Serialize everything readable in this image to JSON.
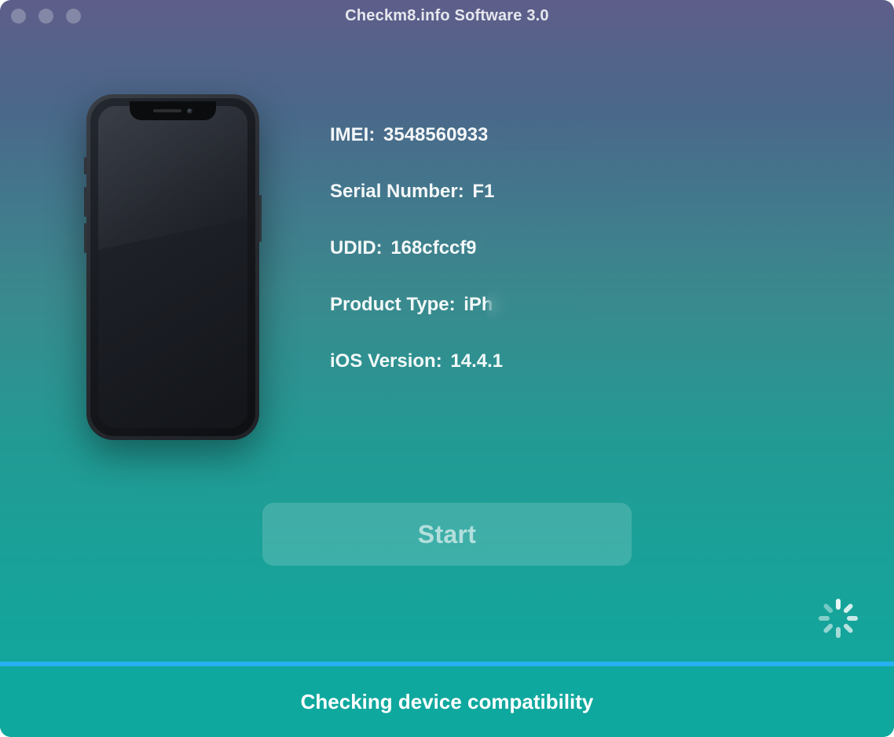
{
  "window": {
    "title": "Checkm8.info Software 3.0"
  },
  "device": {
    "imei": {
      "label": "IMEI:",
      "value_visible": "3548560933"
    },
    "serial": {
      "label": "Serial Number:",
      "value_visible": "F1"
    },
    "udid": {
      "label": "UDID:",
      "value_visible": "168cfccf9"
    },
    "product": {
      "label": "Product Type:",
      "value_visible": "iPh"
    },
    "ios": {
      "label": "iOS Version:",
      "value": "14.4.1"
    }
  },
  "actions": {
    "start_label": "Start"
  },
  "status": {
    "message": "Checking device compatibility"
  }
}
